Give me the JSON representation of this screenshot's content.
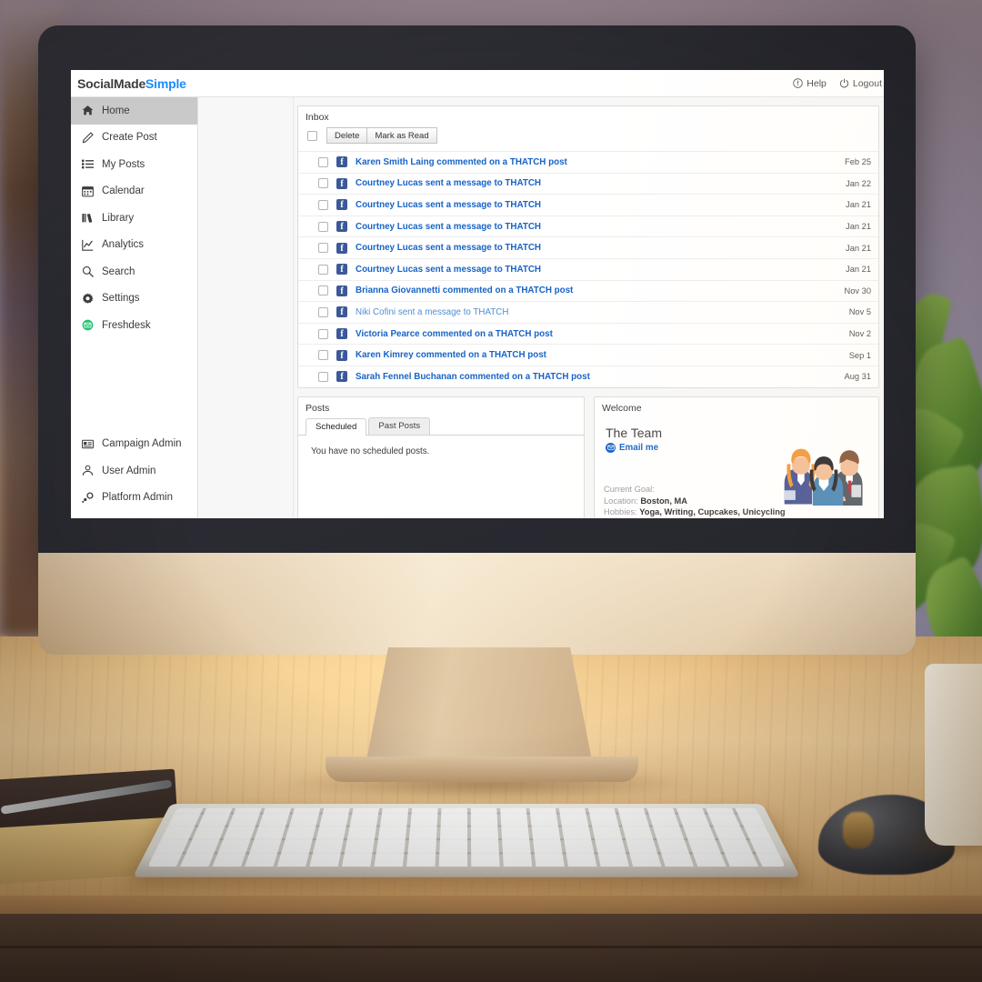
{
  "app": {
    "logo_part1": "SocialMade",
    "logo_part2": "Simple",
    "header_links": [
      {
        "label": "Help",
        "icon": "info-circle-icon"
      },
      {
        "label": "Logout",
        "icon": "power-icon"
      }
    ]
  },
  "sidebar": {
    "top_items": [
      {
        "label": "Home",
        "icon": "home-icon",
        "active": true
      },
      {
        "label": "Create Post",
        "icon": "pencil-icon",
        "active": false
      },
      {
        "label": "My Posts",
        "icon": "list-icon",
        "active": false
      },
      {
        "label": "Calendar",
        "icon": "calendar-icon",
        "active": false
      },
      {
        "label": "Library",
        "icon": "books-icon",
        "active": false
      },
      {
        "label": "Analytics",
        "icon": "chart-line-icon",
        "active": false
      },
      {
        "label": "Search",
        "icon": "search-icon",
        "active": false
      },
      {
        "label": "Settings",
        "icon": "gear-icon",
        "active": false
      },
      {
        "label": "Freshdesk",
        "icon": "freshdesk-icon",
        "active": false
      }
    ],
    "bottom_items": [
      {
        "label": "Campaign Admin",
        "icon": "id-card-icon"
      },
      {
        "label": "User Admin",
        "icon": "users-icon"
      },
      {
        "label": "Platform Admin",
        "icon": "cogs-icon"
      }
    ]
  },
  "inbox": {
    "title": "Inbox",
    "toolbar": {
      "select_all_name": "select-all-checkbox",
      "delete_label": "Delete",
      "mark_read_label": "Mark as Read"
    },
    "messages": [
      {
        "text": "Karen Smith Laing commented on a THATCH post",
        "date": "Feb 25",
        "read": false
      },
      {
        "text": "Courtney Lucas sent a message to THATCH",
        "date": "Jan 22",
        "read": false
      },
      {
        "text": "Courtney Lucas sent a message to THATCH",
        "date": "Jan 21",
        "read": false
      },
      {
        "text": "Courtney Lucas sent a message to THATCH",
        "date": "Jan 21",
        "read": false
      },
      {
        "text": "Courtney Lucas sent a message to THATCH",
        "date": "Jan 21",
        "read": false
      },
      {
        "text": "Courtney Lucas sent a message to THATCH",
        "date": "Jan 21",
        "read": false
      },
      {
        "text": "Brianna Giovannetti commented on a THATCH post",
        "date": "Nov 30",
        "read": false
      },
      {
        "text": "Niki Cofini sent a message to THATCH",
        "date": "Nov 5",
        "read": true
      },
      {
        "text": "Victoria Pearce commented on a THATCH post",
        "date": "Nov 2",
        "read": false
      },
      {
        "text": "Karen Kimrey commented on a THATCH post",
        "date": "Sep 1",
        "read": false
      },
      {
        "text": "Sarah Fennel Buchanan commented on a THATCH post",
        "date": "Aug 31",
        "read": false
      }
    ]
  },
  "posts": {
    "title": "Posts",
    "tabs": [
      {
        "label": "Scheduled",
        "active": true
      },
      {
        "label": "Past Posts",
        "active": false
      }
    ],
    "empty_text": "You have no scheduled posts."
  },
  "welcome": {
    "title": "Welcome",
    "team_name": "The Team",
    "email_link": "Email me",
    "meta": [
      {
        "key": "Current Goal:",
        "value": ""
      },
      {
        "key": "Location:",
        "value": "Boston, MA"
      },
      {
        "key": "Hobbies:",
        "value": "Yoga, Writing, Cupcakes, Unicycling"
      }
    ],
    "image_name": "team-illustration"
  },
  "colors": {
    "brand_blue": "#1a8cff",
    "link_blue": "#1763c6",
    "facebook_blue": "#3b5998",
    "active_nav": "#c9c9c9",
    "freshdesk_green": "#25c16f"
  }
}
